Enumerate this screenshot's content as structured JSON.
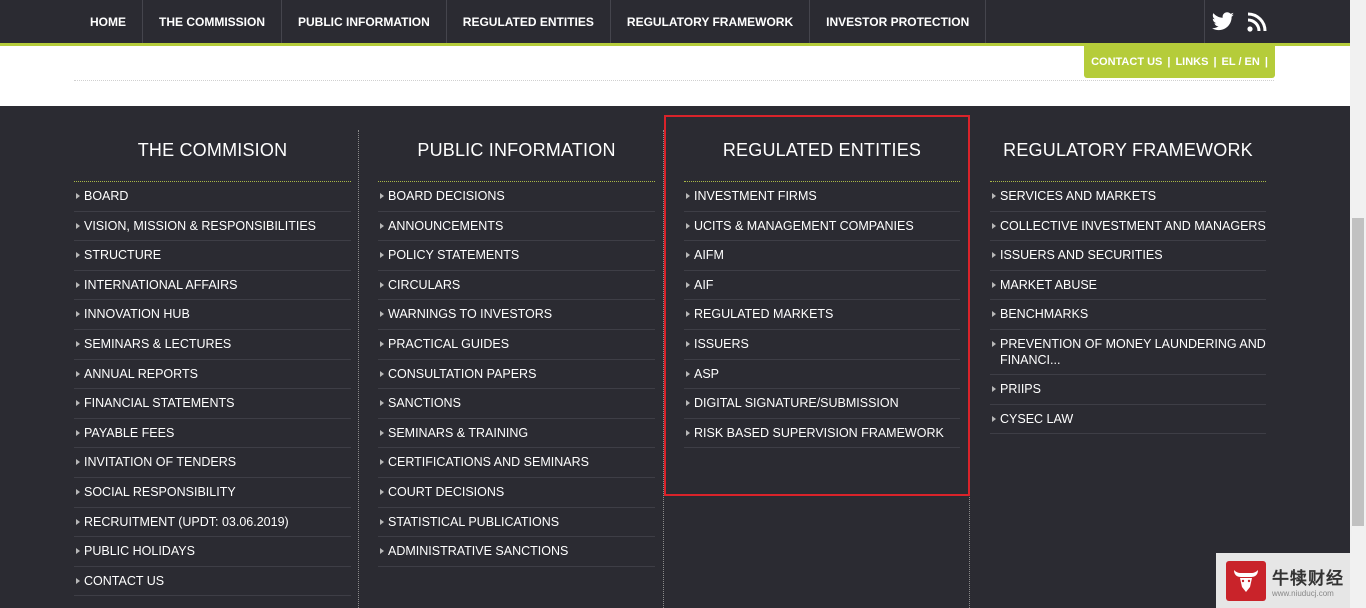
{
  "topnav": {
    "items": [
      "HOME",
      "THE COMMISSION",
      "PUBLIC INFORMATION",
      "REGULATED ENTITIES",
      "REGULATORY FRAMEWORK",
      "INVESTOR PROTECTION"
    ],
    "social_icons": [
      "twitter-icon",
      "rss-icon"
    ],
    "accent_color": "#b5cc3a",
    "background_color": "#2b2b32"
  },
  "contactbar": {
    "contact": "CONTACT US",
    "sep1": "|",
    "links": "LINKS",
    "sep2": "|",
    "lang": "EL / EN",
    "sep3": "|"
  },
  "columns": [
    {
      "title": "THE COMMISION",
      "items": [
        "BOARD",
        "VISION, MISSION & RESPONSIBILITIES",
        "STRUCTURE",
        "INTERNATIONAL AFFAIRS",
        "INNOVATION HUB",
        "SEMINARS & LECTURES",
        "ANNUAL REPORTS",
        "FINANCIAL STATEMENTS",
        "PAYABLE FEES",
        "INVITATION OF TENDERS",
        "SOCIAL RESPONSIBILITY",
        "RECRUITMENT (UPDT: 03.06.2019)",
        "PUBLIC HOLIDAYS",
        "CONTACT US"
      ]
    },
    {
      "title": "PUBLIC INFORMATION",
      "items": [
        "BOARD DECISIONS",
        "ANNOUNCEMENTS",
        "POLICY STATEMENTS",
        "CIRCULARS",
        "WARNINGS TO INVESTORS",
        "PRACTICAL GUIDES",
        "CONSULTATION PAPERS",
        "SANCTIONS",
        "SEMINARS & TRAINING",
        "CERTIFICATIONS AND SEMINARS",
        "COURT DECISIONS",
        "STATISTICAL PUBLICATIONS",
        "ADMINISTRATIVE SANCTIONS"
      ]
    },
    {
      "title": "REGULATED ENTITIES",
      "items": [
        "INVESTMENT FIRMS",
        "UCITS & MANAGEMENT COMPANIES",
        "AIFM",
        "AIF",
        "REGULATED MARKETS",
        "ISSUERS",
        "ASP",
        "DIGITAL SIGNATURE/SUBMISSION",
        "RISK BASED SUPERVISION FRAMEWORK"
      ]
    },
    {
      "title": "REGULATORY FRAMEWORK",
      "items": [
        "SERVICES AND MARKETS",
        "COLLECTIVE INVESTMENT AND MANAGERS",
        "ISSUERS AND SECURITIES",
        "MARKET ABUSE",
        "BENCHMARKS",
        "PREVENTION OF MONEY LAUNDERING AND FINANCI...",
        "PRIIPS",
        "CYSEC LAW"
      ]
    }
  ],
  "highlight_color": "#d9232a",
  "watermark": {
    "name": "牛犊财经",
    "url": "www.niuducj.com"
  }
}
